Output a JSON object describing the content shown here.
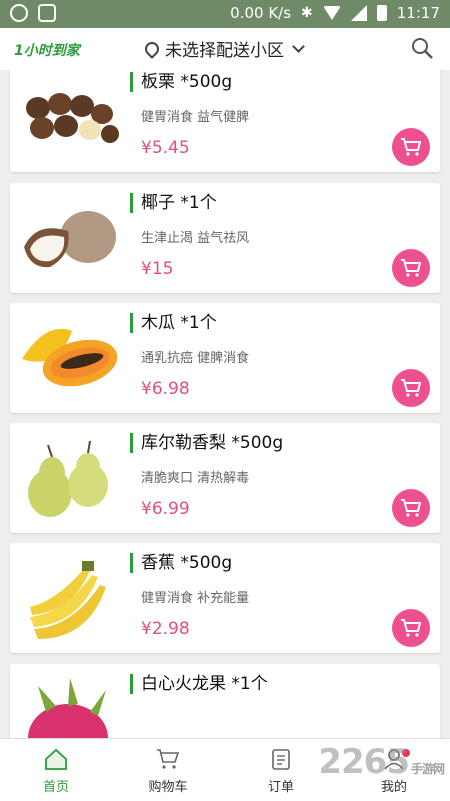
{
  "status_bar": {
    "speed": "0.00 K/s",
    "time": "11:17"
  },
  "header": {
    "logo": "1小时到家",
    "location": "未选择配送小区",
    "icons": [
      "location-pin-icon",
      "chevron-down-icon",
      "search-icon"
    ]
  },
  "products": [
    {
      "title": "板栗 *500g",
      "desc": "健胃消食 益气健脾",
      "price": "¥5.45",
      "image": "chestnut"
    },
    {
      "title": "椰子 *1个",
      "desc": "生津止渴 益气祛风",
      "price": "¥15",
      "image": "coconut"
    },
    {
      "title": "木瓜 *1个",
      "desc": "通乳抗癌 健脾消食",
      "price": "¥6.98",
      "image": "papaya"
    },
    {
      "title": "库尔勒香梨 *500g",
      "desc": "清脆爽口 清热解毒",
      "price": "¥6.99",
      "image": "pear"
    },
    {
      "title": "香蕉 *500g",
      "desc": "健胃消食 补充能量",
      "price": "¥2.98",
      "image": "banana"
    },
    {
      "title": "白心火龙果 *1个",
      "desc": "",
      "price": "",
      "image": "dragon-fruit"
    }
  ],
  "tabs": [
    {
      "label": "首页",
      "icon": "home-icon",
      "active": true
    },
    {
      "label": "购物车",
      "icon": "cart-icon"
    },
    {
      "label": "订单",
      "icon": "order-icon"
    },
    {
      "label": "我的",
      "icon": "user-icon"
    }
  ],
  "watermark": {
    "text": "2265",
    "sub": "手游网"
  },
  "colors": {
    "accent": "#2a9d3a",
    "price": "#e24f7d",
    "cart_button": "#ee4f8f",
    "statusbar": "#6f8a67"
  }
}
